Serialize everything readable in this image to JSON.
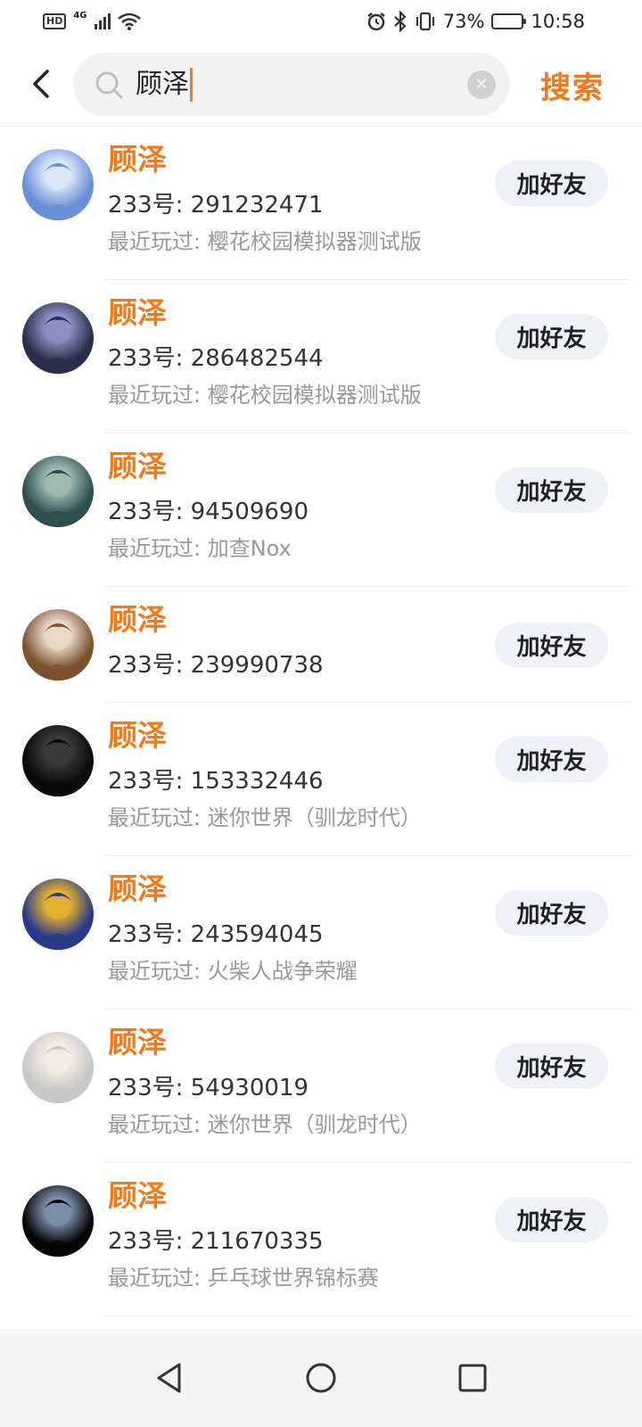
{
  "status_bar": {
    "hd_label": "HD",
    "network_type": "4G",
    "battery_percent": "73%",
    "battery_level": 0.73,
    "time": "10:58"
  },
  "search": {
    "query": "顾泽",
    "submit_label": "搜索"
  },
  "results": [
    {
      "name": "顾泽",
      "id_text": "233号: 291232471",
      "recent": "最近玩过: 樱花校园模拟器测试版",
      "button": "加好友",
      "avatar_icon": "anime-blue-hair-avatar",
      "avatar_colors": [
        "#6a8fd6",
        "#d9e6f7"
      ]
    },
    {
      "name": "顾泽",
      "id_text": "233号: 286482544",
      "recent": "最近玩过: 樱花校园模拟器测试版",
      "button": "加好友",
      "avatar_icon": "anime-volleyball-avatar",
      "avatar_colors": [
        "#2b2d4a",
        "#8a90c0"
      ]
    },
    {
      "name": "顾泽",
      "id_text": "233号: 94509690",
      "recent": "最近玩过: 加查Nox",
      "button": "加好友",
      "avatar_icon": "anime-green-hair-avatar",
      "avatar_colors": [
        "#2f4f4f",
        "#9fb8b0"
      ]
    },
    {
      "name": "顾泽",
      "id_text": "233号: 239990738",
      "recent": "",
      "button": "加好友",
      "avatar_icon": "anime-brown-hair-avatar",
      "avatar_colors": [
        "#7a5230",
        "#e8d8c8"
      ]
    },
    {
      "name": "顾泽",
      "id_text": "233号: 153332446",
      "recent": "最近玩过: 迷你世界（驯龙时代）",
      "button": "加好友",
      "avatar_icon": "dark-portrait-avatar",
      "avatar_colors": [
        "#0a0a0a",
        "#3a3a3a"
      ]
    },
    {
      "name": "顾泽",
      "id_text": "233号: 243594045",
      "recent": "最近玩过: 火柴人战争荣耀",
      "button": "加好友",
      "avatar_icon": "anubis-mask-avatar",
      "avatar_colors": [
        "#2a3a8a",
        "#e0b030"
      ]
    },
    {
      "name": "顾泽",
      "id_text": "233号: 54930019",
      "recent": "最近玩过: 迷你世界（驯龙时代）",
      "button": "加好友",
      "avatar_icon": "white-hair-avatar",
      "avatar_colors": [
        "#c8c8c8",
        "#f2ece4"
      ]
    },
    {
      "name": "顾泽",
      "id_text": "233号: 211670335",
      "recent": "最近玩过: 乒乓球世界锦标赛",
      "button": "加好友",
      "avatar_icon": "standing-figure-avatar",
      "avatar_colors": [
        "#050505",
        "#7a8ea8"
      ]
    }
  ],
  "colors": {
    "accent": "#f07a1a",
    "secondary_text": "#999999",
    "button_bg": "#eef1f5"
  }
}
